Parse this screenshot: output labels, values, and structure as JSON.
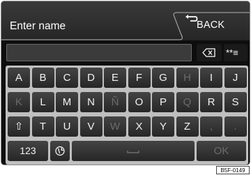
{
  "header": {
    "title": "Enter name",
    "back_label": "BACK"
  },
  "input": {
    "value": ""
  },
  "toolbar": {
    "backspace_icon": "backspace-icon",
    "password_toggle_label": "**≡"
  },
  "keyboard": {
    "row1": [
      {
        "label": "A",
        "enabled": true
      },
      {
        "label": "B",
        "enabled": true
      },
      {
        "label": "C",
        "enabled": true
      },
      {
        "label": "D",
        "enabled": true
      },
      {
        "label": "E",
        "enabled": true
      },
      {
        "label": "F",
        "enabled": true
      },
      {
        "label": "G",
        "enabled": true
      },
      {
        "label": "H",
        "enabled": false
      },
      {
        "label": "I",
        "enabled": true
      },
      {
        "label": "J",
        "enabled": true
      }
    ],
    "row2": [
      {
        "label": "K",
        "enabled": false
      },
      {
        "label": "L",
        "enabled": true
      },
      {
        "label": "M",
        "enabled": true
      },
      {
        "label": "N",
        "enabled": true
      },
      {
        "label": "Ñ",
        "enabled": false
      },
      {
        "label": "O",
        "enabled": true
      },
      {
        "label": "P",
        "enabled": true
      },
      {
        "label": "Q",
        "enabled": false
      },
      {
        "label": "R",
        "enabled": true
      },
      {
        "label": "S",
        "enabled": true
      }
    ],
    "row3": [
      {
        "label": "⇧",
        "enabled": true
      },
      {
        "label": "T",
        "enabled": true
      },
      {
        "label": "U",
        "enabled": true
      },
      {
        "label": "V",
        "enabled": true
      },
      {
        "label": "W",
        "enabled": false
      },
      {
        "label": "X",
        "enabled": true
      },
      {
        "label": "Y",
        "enabled": true
      },
      {
        "label": "Z",
        "enabled": true
      },
      {
        "label": ",",
        "enabled": false
      },
      {
        "label": ".",
        "enabled": false
      }
    ],
    "row4": {
      "numbers_label": "123",
      "globe_icon": "globe-icon",
      "space_icon": "space-bar-icon",
      "ok_label": "OK",
      "ok_enabled": false
    }
  },
  "reference_code": "B5F-0149"
}
